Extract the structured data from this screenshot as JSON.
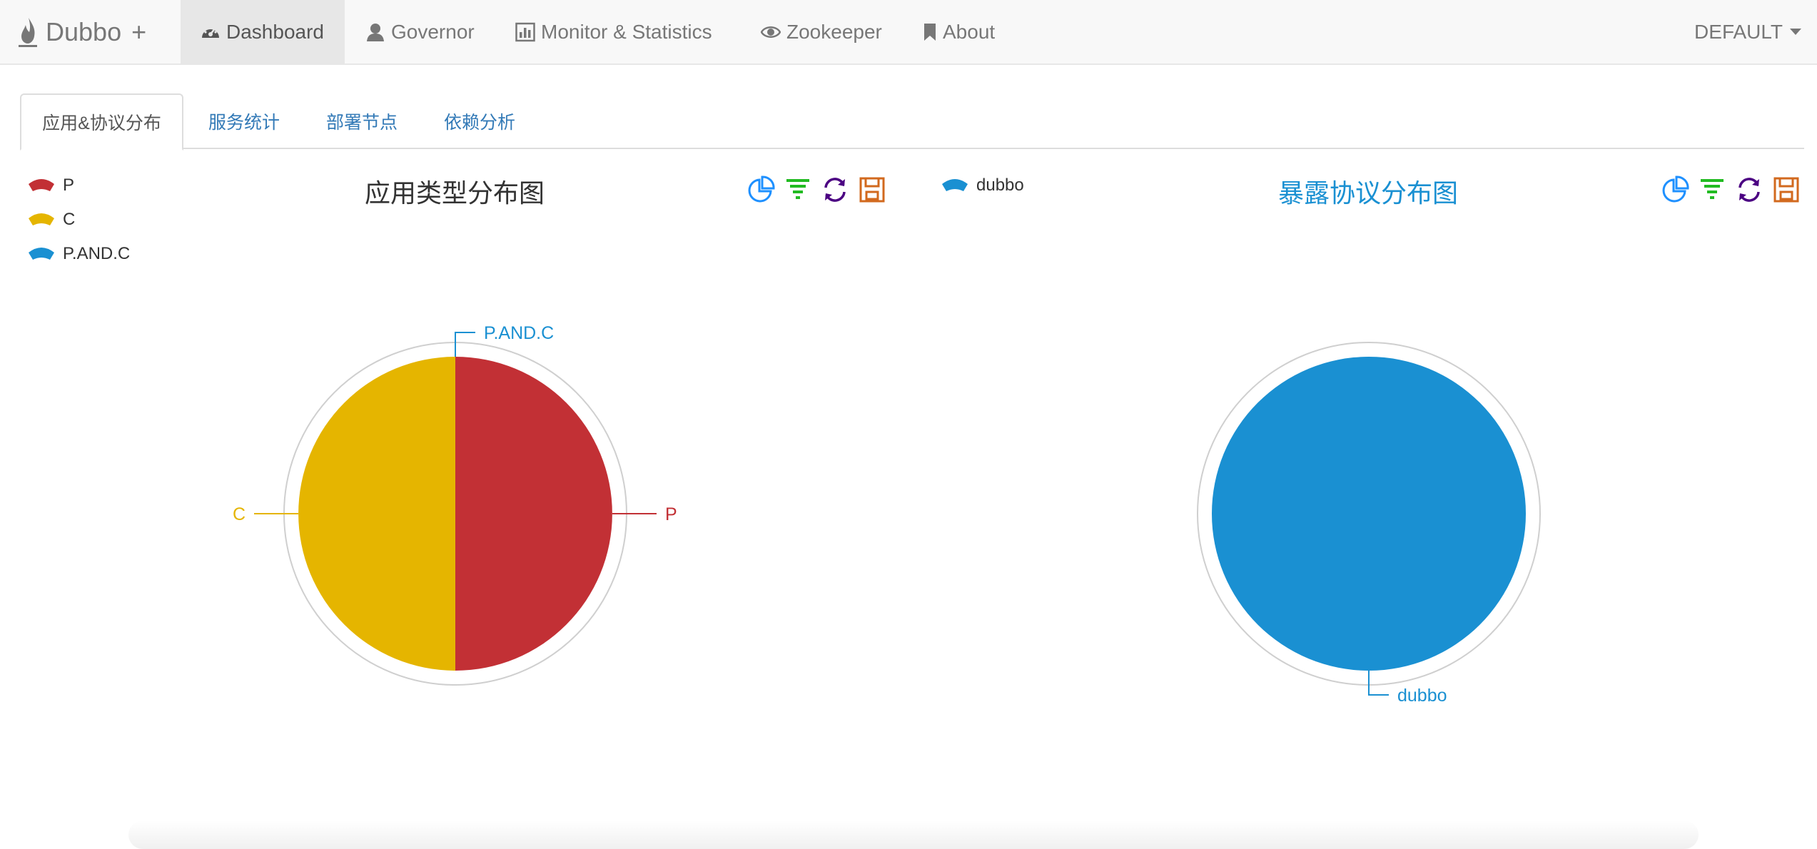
{
  "navbar": {
    "brand": "Dubbo",
    "brand_plus": "+",
    "items": [
      {
        "label": "Dashboard",
        "icon": "dashboard-icon",
        "active": true
      },
      {
        "label": "Governor",
        "icon": "user-icon",
        "active": false
      },
      {
        "label": "Monitor & Statistics",
        "icon": "bar-chart-icon",
        "active": false
      },
      {
        "label": "Zookeeper",
        "icon": "eye-icon",
        "active": false
      },
      {
        "label": "About",
        "icon": "bookmark-icon",
        "active": false
      }
    ],
    "registry": "DEFAULT"
  },
  "tabs": [
    {
      "label": "应用&协议分布",
      "active": true
    },
    {
      "label": "服务统计",
      "active": false
    },
    {
      "label": "部署节点",
      "active": false
    },
    {
      "label": "依赖分析",
      "active": false
    }
  ],
  "toolbox": [
    {
      "name": "pie-chart-icon",
      "color": "#1e90ff"
    },
    {
      "name": "funnel-icon",
      "color": "#22bb22"
    },
    {
      "name": "refresh-icon",
      "color": "#4b0082"
    },
    {
      "name": "save-icon",
      "color": "#d2691e"
    }
  ],
  "chart_data": [
    {
      "type": "pie",
      "title": "应用类型分布图",
      "legend": [
        "P",
        "C",
        "P.AND.C"
      ],
      "legend_position": "top-left",
      "series": [
        {
          "name": "P",
          "value": 1,
          "color": "#c23035"
        },
        {
          "name": "C",
          "value": 1,
          "color": "#e5b500"
        },
        {
          "name": "P.AND.C",
          "value": 0,
          "color": "#1a90d2"
        }
      ]
    },
    {
      "type": "pie",
      "title": "暴露协议分布图",
      "legend": [
        "dubbo"
      ],
      "legend_position": "top-left",
      "series": [
        {
          "name": "dubbo",
          "value": 1,
          "color": "#1a90d2"
        }
      ]
    }
  ]
}
